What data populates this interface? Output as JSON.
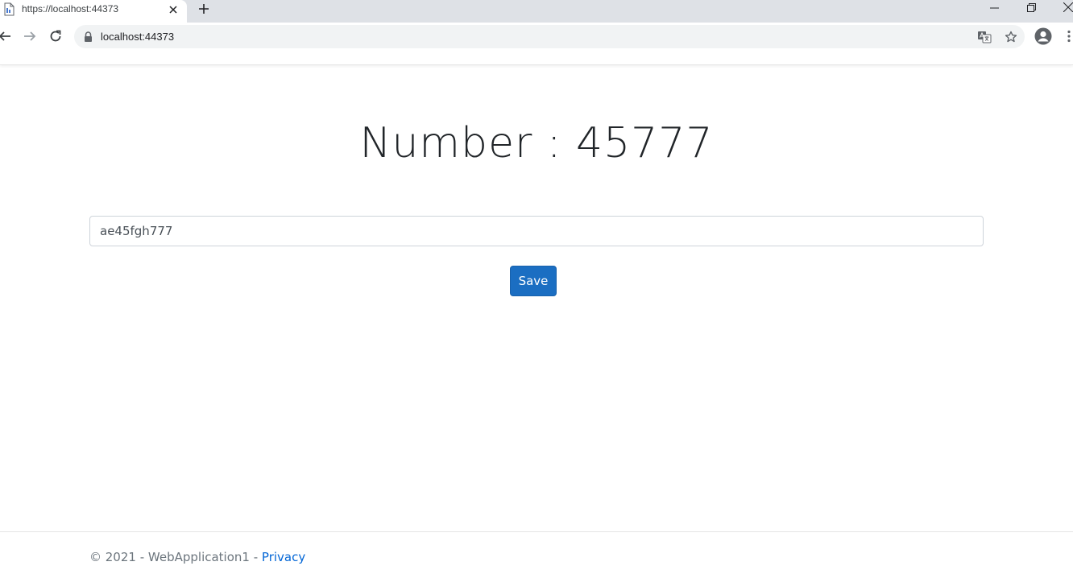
{
  "browser": {
    "tab_title": "https://localhost:44373",
    "url": "localhost:44373",
    "icons": {
      "favicon": "page-icon",
      "tab_close": "close-icon",
      "new_tab": "plus-icon",
      "minimize": "minimize-icon",
      "restore": "restore-icon",
      "window_close": "close-icon",
      "back": "arrow-left-icon",
      "forward": "arrow-right-icon",
      "reload": "reload-icon",
      "lock": "lock-icon",
      "translate": "translate-icon",
      "bookmark": "star-icon",
      "profile": "account-icon",
      "menu": "more-vertical-icon"
    }
  },
  "main": {
    "heading": "Number : 45777",
    "input_value": "ae45fgh777",
    "save_label": "Save"
  },
  "footer": {
    "copyright": "© 2021 - WebApplication1 - ",
    "privacy_label": "Privacy"
  },
  "colors": {
    "primary_button": "#1b6ec2",
    "link": "#0366d6",
    "tabstrip": "#dee1e6"
  }
}
